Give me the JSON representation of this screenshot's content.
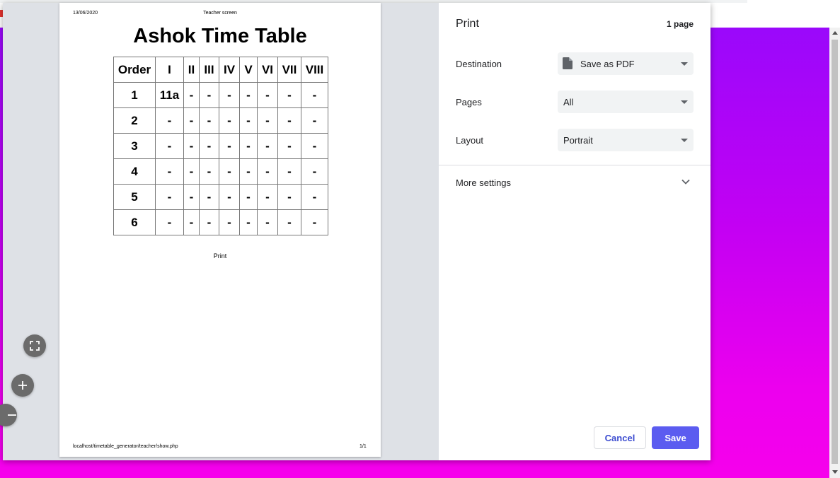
{
  "preview": {
    "header_date": "13/06/2020",
    "header_title": "Teacher screen",
    "doc_title": "Ashok Time Table",
    "table": {
      "headers": [
        "Order",
        "I",
        "II",
        "III",
        "IV",
        "V",
        "VI",
        "VII",
        "VIII"
      ],
      "rows": [
        [
          "1",
          "11a",
          "-",
          "-",
          "-",
          "-",
          "-",
          "-",
          "-"
        ],
        [
          "2",
          "-",
          "-",
          "-",
          "-",
          "-",
          "-",
          "-",
          "-"
        ],
        [
          "3",
          "-",
          "-",
          "-",
          "-",
          "-",
          "-",
          "-",
          "-"
        ],
        [
          "4",
          "-",
          "-",
          "-",
          "-",
          "-",
          "-",
          "-",
          "-"
        ],
        [
          "5",
          "-",
          "-",
          "-",
          "-",
          "-",
          "-",
          "-",
          "-"
        ],
        [
          "6",
          "-",
          "-",
          "-",
          "-",
          "-",
          "-",
          "-",
          "-"
        ]
      ]
    },
    "print_link": "Print",
    "footer_url": "localhost/timetable_generator/teacher/show.php",
    "footer_page": "1/1"
  },
  "zoom": {
    "fit_icon": "fit-to-page-icon",
    "zoom_in_icon": "plus-icon",
    "zoom_out_icon": "minus-icon"
  },
  "settings": {
    "title": "Print",
    "page_count": "1 page",
    "destination_label": "Destination",
    "destination_value": "Save as PDF",
    "destination_icon": "file-icon",
    "pages_label": "Pages",
    "pages_value": "All",
    "layout_label": "Layout",
    "layout_value": "Portrait",
    "more_settings": "More settings",
    "cancel": "Cancel",
    "save": "Save"
  },
  "colors": {
    "accent": "#5b5cf0",
    "background_top": "#9a08fb",
    "background_bottom": "#f600ec"
  }
}
